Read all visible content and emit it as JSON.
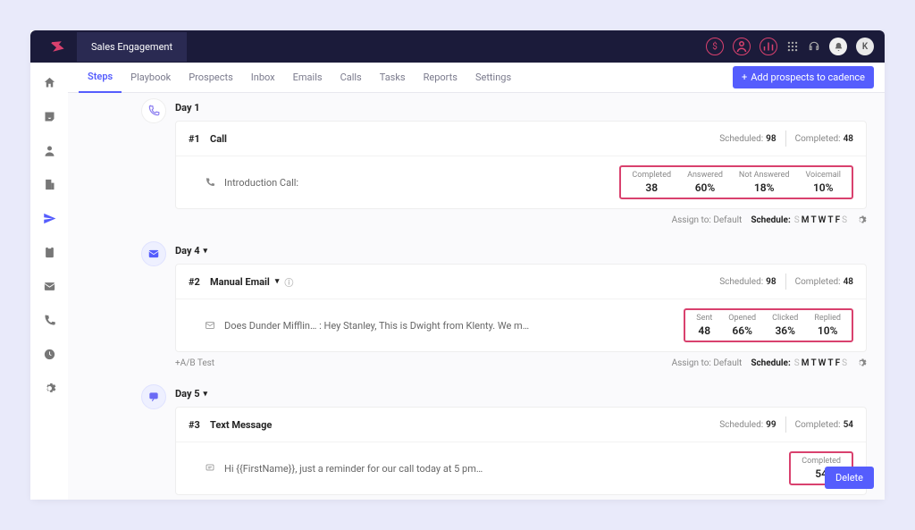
{
  "brand_tab": "Sales Engagement",
  "avatar_letter": "K",
  "tabs": [
    "Steps",
    "Playbook",
    "Prospects",
    "Inbox",
    "Emails",
    "Calls",
    "Tasks",
    "Reports",
    "Settings"
  ],
  "add_prospects_label": "Add prospects to cadence",
  "delete_label": "Delete",
  "assign_label": "Assign to:",
  "assign_value": "Default",
  "schedule_label": "Schedule:",
  "schedule_days": [
    "S",
    "M",
    "T",
    "W",
    "T",
    "F",
    "S"
  ],
  "ab_test_label": "+A/B Test",
  "step1": {
    "day": "Day 1",
    "num": "#1",
    "title": "Call",
    "scheduled_label": "Scheduled:",
    "scheduled": "98",
    "completed_label": "Completed:",
    "completed": "48",
    "body": "Introduction Call:",
    "metrics": [
      {
        "label": "Completed",
        "value": "38"
      },
      {
        "label": "Answered",
        "value": "60%"
      },
      {
        "label": "Not Answered",
        "value": "18%"
      },
      {
        "label": "Voicemail",
        "value": "10%"
      }
    ]
  },
  "step2": {
    "day": "Day 4",
    "num": "#2",
    "title": "Manual Email",
    "scheduled_label": "Scheduled:",
    "scheduled": "98",
    "completed_label": "Completed:",
    "completed": "48",
    "body": "Does Dunder Mifflin… : Hey Stanley,   This is Dwight from Klenty. We m…",
    "metrics": [
      {
        "label": "Sent",
        "value": "48"
      },
      {
        "label": "Opened",
        "value": "66%"
      },
      {
        "label": "Clicked",
        "value": "36%"
      },
      {
        "label": "Replied",
        "value": "10%"
      }
    ]
  },
  "step3": {
    "day": "Day 5",
    "num": "#3",
    "title": "Text Message",
    "scheduled_label": "Scheduled:",
    "scheduled": "99",
    "completed_label": "Completed:",
    "completed": "54",
    "body": "Hi {{FirstName}}, just a reminder for our call today at 5 pm…",
    "metrics": [
      {
        "label": "Completed",
        "value": "54"
      }
    ]
  }
}
